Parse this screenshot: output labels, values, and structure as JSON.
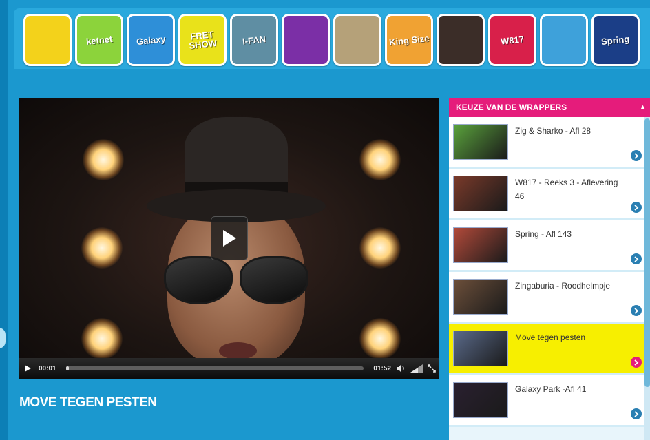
{
  "shows": [
    {
      "name": "show-tile-1",
      "label": "",
      "bg": "#f3d21b"
    },
    {
      "name": "show-tile-ketnet",
      "label": "ketnet",
      "bg": "#8cd33b"
    },
    {
      "name": "show-tile-galaxy",
      "label": "Galaxy",
      "bg": "#2e8fd8"
    },
    {
      "name": "show-tile-fret-show",
      "label": "FRET SHOW",
      "bg": "#e9e21a"
    },
    {
      "name": "show-tile-i-fan",
      "label": "I-FAN",
      "bg": "#5f8ea3"
    },
    {
      "name": "show-tile-6",
      "label": "",
      "bg": "#7b2fa6"
    },
    {
      "name": "show-tile-7",
      "label": "",
      "bg": "#b5a179"
    },
    {
      "name": "show-tile-king-size",
      "label": "King Size",
      "bg": "#f0a233"
    },
    {
      "name": "show-tile-9",
      "label": "",
      "bg": "#3b2d28"
    },
    {
      "name": "show-tile-w817",
      "label": "W817",
      "bg": "#d8204a"
    },
    {
      "name": "show-tile-11",
      "label": "",
      "bg": "#3ea1da"
    },
    {
      "name": "show-tile-spring",
      "label": "Spring",
      "bg": "#1b3e87"
    }
  ],
  "player": {
    "current_time": "00:01",
    "duration": "01:52",
    "progress": 0.01
  },
  "video_title": "MOVE TEGEN PESTEN",
  "sidebar": {
    "header": "KEUZE VAN DE WRAPPERS",
    "header_arrow": "▲",
    "items": [
      {
        "label": "Zig & Sharko - Afl 28",
        "thumb_bg": "#5aa23c",
        "active": false
      },
      {
        "label": "W817 - Reeks 3 - Aflevering 46",
        "thumb_bg": "#7a3a2a",
        "active": false
      },
      {
        "label": "Spring - Afl 143",
        "thumb_bg": "#b24a3a",
        "active": false
      },
      {
        "label": "Zingaburia - Roodhelmpje",
        "thumb_bg": "#6c4f3a",
        "active": false
      },
      {
        "label": "Move tegen pesten",
        "thumb_bg": "#5a6a8a",
        "active": true
      },
      {
        "label": "Galaxy Park -Afl 41",
        "thumb_bg": "#2a2030",
        "active": false
      }
    ]
  }
}
